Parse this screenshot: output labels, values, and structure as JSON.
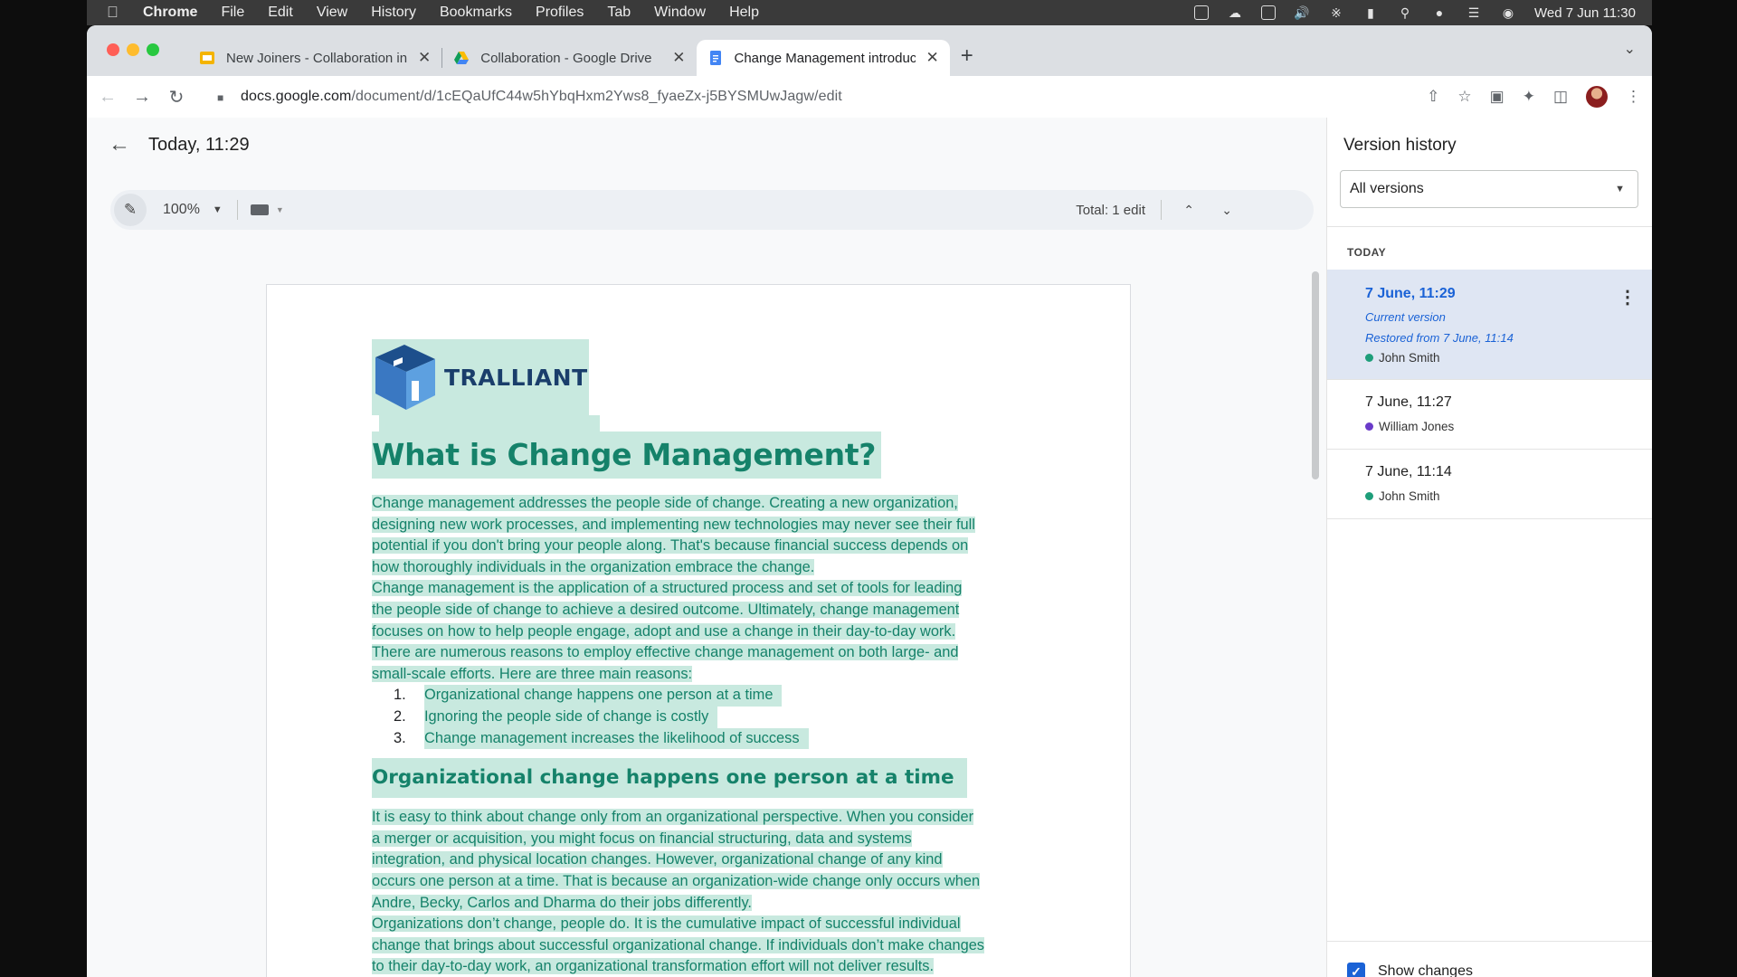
{
  "menubar": {
    "app": "Chrome",
    "items": [
      "File",
      "Edit",
      "View",
      "History",
      "Bookmarks",
      "Profiles",
      "Tab",
      "Window",
      "Help"
    ],
    "clock": "Wed 7 Jun  11:30"
  },
  "tabs": [
    {
      "title": "New Joiners - Collaboration in",
      "icon": "slides-icon",
      "color": "#f4b400"
    },
    {
      "title": "Collaboration - Google Drive",
      "icon": "drive-icon",
      "color": "#0f9d58"
    },
    {
      "title": "Change Management introduct",
      "icon": "docs-icon",
      "color": "#4285f4",
      "active": true
    }
  ],
  "address_bar": {
    "host": "docs.google.com",
    "path": "/document/d/1cEQaUfC44w5hYbqHxm2Yws8_fyaeZx-j5BYSMUwJagw/edit"
  },
  "version_header": {
    "title": "Today, 11:29"
  },
  "doc_toolbar": {
    "zoom": "100%",
    "total_edits": "Total: 1 edit"
  },
  "document": {
    "logo_text": "TRALLIANT",
    "heading1": "What is Change Management?",
    "para1_lines": [
      "Change management addresses the people side of change. Creating a new organization,",
      "designing new work processes, and implementing new technologies may never see their full",
      "potential if you don't bring your people along. That's because financial success depends on",
      "how thoroughly individuals in the organization embrace the change."
    ],
    "para2_lines": [
      "Change management is the application of a structured process and set of tools for leading",
      "the people side of change to achieve a desired outcome. Ultimately, change management",
      "focuses on how to help people engage, adopt and use a change in their day-to-day work."
    ],
    "para3_lines": [
      "There are numerous reasons to employ effective change management on both large- and",
      "small-scale efforts. Here are three main reasons:"
    ],
    "list": [
      {
        "num": "1.",
        "text": "Organizational change happens one person at a time"
      },
      {
        "num": "2.",
        "text": "Ignoring the people side of change is costly"
      },
      {
        "num": "3.",
        "text": "Change management increases the likelihood of success"
      }
    ],
    "heading2": "Organizational change happens one person at a time",
    "para4_lines": [
      "It is easy to think about change only from an organizational perspective. When you consider",
      "a merger or acquisition, you might focus on financial structuring, data and systems",
      "integration, and physical location changes. However, organizational change of any kind",
      "occurs one person at a time. That is because an organization-wide change only occurs when",
      "Andre, Becky, Carlos and Dharma do their jobs differently."
    ],
    "para5_lines": [
      "Organizations don’t change, people do. It is the cumulative impact of successful individual",
      "change that brings about successful organizational change. If individuals don’t make changes",
      "to their day-to-day work, an organizational transformation effort will not deliver results."
    ]
  },
  "version_panel": {
    "title": "Version history",
    "filter": "All versions",
    "group_label": "TODAY",
    "versions": [
      {
        "date": "7 June, 11:29",
        "note1": "Current version",
        "note2": "Restored from 7 June, 11:14",
        "user": "John Smith",
        "user_color": "#1e9e7a"
      },
      {
        "date": "7 June, 11:27",
        "user": "William Jones",
        "user_color": "#6a3bc9"
      },
      {
        "date": "7 June, 11:14",
        "user": "John Smith",
        "user_color": "#1e9e7a"
      }
    ],
    "show_changes_label": "Show changes",
    "show_changes_checked": true
  },
  "colors": {
    "accent": "#1a62d6",
    "doc_text": "#15826a",
    "change_highlight": "#c8e9df"
  }
}
